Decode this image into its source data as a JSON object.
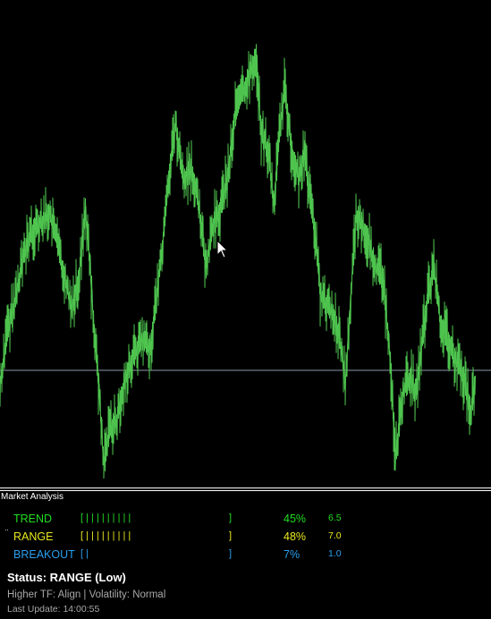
{
  "colors": {
    "background": "#000000",
    "price_line": "#4ec44e",
    "horizontal_line": "#8a9aa8",
    "trend": "#22dd22",
    "range": "#e8e820",
    "breakout": "#2a9ff0",
    "status": "#ffffff",
    "secondary_text": "#a8a8a8"
  },
  "chart": {
    "type": "tick-line",
    "icon": "mouse-pointer-icon"
  },
  "panel": {
    "title": "Market Analysis",
    "rows": [
      {
        "marker": "",
        "name": "TREND",
        "bar_open": "[ | | | | | | | | |",
        "bar_close": "]",
        "percent": "45%",
        "score": "6.5"
      },
      {
        "marker": "¨",
        "name": "RANGE",
        "bar_open": "[ | | | | | | | | |",
        "bar_close": "]",
        "percent": "48%",
        "score": "7.0"
      },
      {
        "marker": "",
        "name": "BREAKOUT",
        "bar_open": "[ |",
        "bar_close": "]",
        "percent": "7%",
        "score": "1.0"
      }
    ],
    "status": "Status: RANGE (Low)",
    "higher_tf": "Higher TF: Align | Volatility: Normal",
    "last_update": "Last Update: 14:00:55"
  }
}
